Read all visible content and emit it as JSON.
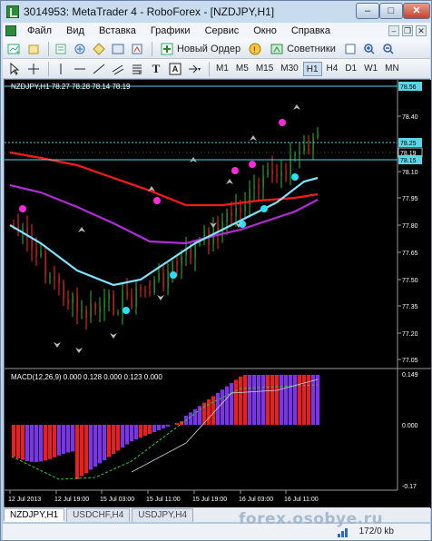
{
  "window": {
    "title": "3014953: MetaTrader 4 - RoboForex - [NZDJPY,H1]",
    "min": "–",
    "max": "□",
    "close": "✕"
  },
  "menu": [
    "Файл",
    "Вид",
    "Вставка",
    "Графики",
    "Сервис",
    "Окно",
    "Справка"
  ],
  "mdi_controls": [
    "–",
    "❐",
    "✕"
  ],
  "toolbar1": {
    "new_order": "Новый Ордер",
    "experts": "Советники"
  },
  "toolbar2": {
    "timeframes": [
      "M1",
      "M5",
      "M15",
      "M30",
      "H1",
      "H4",
      "D1",
      "W1",
      "MN"
    ],
    "active_timeframe": "H1",
    "tool_letters": [
      "T",
      "A"
    ]
  },
  "chart": {
    "header": "NZDJPY,H1  78.27 78.28 78.14 78.19",
    "price_labels": [
      "78.40",
      "78.10",
      "77.95",
      "77.80",
      "77.65",
      "77.50",
      "77.35",
      "77.20",
      "77.05"
    ],
    "price_tags": {
      "top": "78.56",
      "upper": "78.25",
      "mid": "78.19",
      "lower": "78.15"
    },
    "macd_header": "MACD(12,26,9) 0.000 0.128 0.000 0.123 0.000",
    "macd_labels": {
      "top": "0.149",
      "zero": "0.000",
      "bottom": "-0.17"
    },
    "time_labels": [
      "12 Jul 2013",
      "12 Jul 19:00",
      "15 Jul 03:00",
      "15 Jul 11:00",
      "15 Jul 19:00",
      "16 Jul 03:00",
      "16 Jul 11:00"
    ]
  },
  "tabs": [
    "NZDJPY,H1",
    "USDCHF,H4",
    "USDJPY,H4"
  ],
  "active_tab": "NZDJPY,H1",
  "status": {
    "traffic": "172/0 kb"
  },
  "watermark": "forex.osobye.ru",
  "colors": {
    "bull": "#2fb82f",
    "bear": "#ff2a2a",
    "ma_red": "#ff1a1a",
    "ma_purple": "#b02cd8",
    "ma_cyan": "#7ee3ff",
    "dot_magenta": "#ff2ad8",
    "dot_cyan": "#28e1ff",
    "macd_red": "#e52020",
    "macd_blue": "#7a35e6",
    "hline": "#5ad6e8"
  }
}
